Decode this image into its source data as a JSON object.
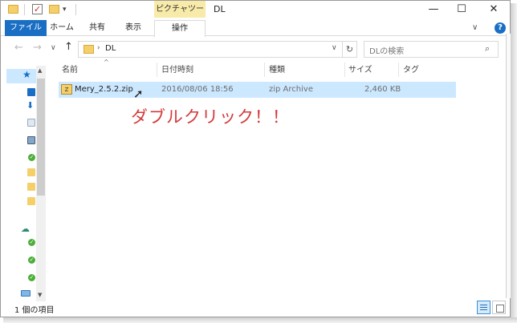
{
  "window": {
    "title": "DL",
    "context_tab": "ピクチャツール",
    "quick_access": [
      "folder-icon",
      "properties-check-icon",
      "new-folder-icon",
      "customize-dropdown-icon"
    ],
    "controls": {
      "minimize": "—",
      "maximize": "☐",
      "close": "✕"
    }
  },
  "ribbon": {
    "tabs": [
      {
        "label": "ファイル",
        "active": true
      },
      {
        "label": "ホーム"
      },
      {
        "label": "共有"
      },
      {
        "label": "表示"
      },
      {
        "label": "操作"
      }
    ],
    "collapse_glyph": "∨",
    "help_glyph": "?"
  },
  "address": {
    "back": "←",
    "forward": "→",
    "recent": "∨",
    "up": "↑",
    "separator": "›",
    "path": "DL",
    "refresh_glyph": "↻",
    "dropdown_glyph": "∨",
    "search_placeholder": "DLの検索"
  },
  "columns": {
    "name": "名前",
    "date": "日付時刻",
    "type": "種類",
    "size": "サイズ",
    "tag": "タグ"
  },
  "files": [
    {
      "name": "Mery_2.5.2.zip",
      "date": "2016/08/06 18:56",
      "type": "zip Archive",
      "size": "2,460 KB"
    }
  ],
  "annotation": "ダブルクリック！！",
  "status": {
    "item_count": "1 個の項目"
  },
  "colors": {
    "accent": "#1a6fc4",
    "selection": "#cce8ff",
    "annotation": "#d43a3a",
    "folder": "#f4cf6a"
  }
}
